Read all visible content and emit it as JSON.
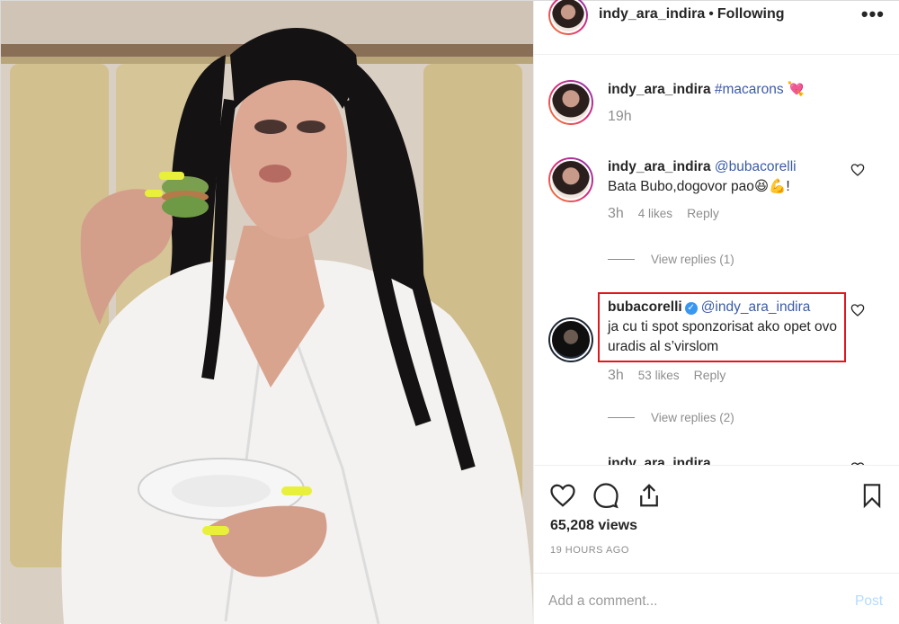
{
  "header": {
    "username": "indy_ara_indira",
    "separator": "•",
    "follow_status": "Following",
    "more": "•••"
  },
  "caption": {
    "username": "indy_ara_indira",
    "hashtag": "#macarons",
    "emoji": "💘",
    "time": "19h"
  },
  "comments": [
    {
      "username": "indy_ara_indira",
      "mention": "@bubacorelli",
      "text": "Bata Bubo,dogovor pao😆💪!",
      "time": "3h",
      "likes": "4 likes",
      "reply": "Reply",
      "view_replies": "View replies (1)"
    },
    {
      "username": "bubacorelli",
      "verified": "✓",
      "mention": "@indy_ara_indira",
      "text": "ja cu ti spot sponzorisat ako opet ovo uradis al s’virslom",
      "time": "3h",
      "likes": "53 likes",
      "reply": "Reply",
      "view_replies": "View replies (2)"
    },
    {
      "username": "indy_ara_indira"
    }
  ],
  "actions": {
    "views": "65,208 views",
    "posted_ago": "19 HOURS AGO"
  },
  "add_comment": {
    "placeholder": "Add a comment...",
    "post_label": "Post"
  },
  "colors": {
    "link": "#3b5ba7",
    "highlight_border": "#e0181d",
    "post_button": "#b3dbff"
  }
}
